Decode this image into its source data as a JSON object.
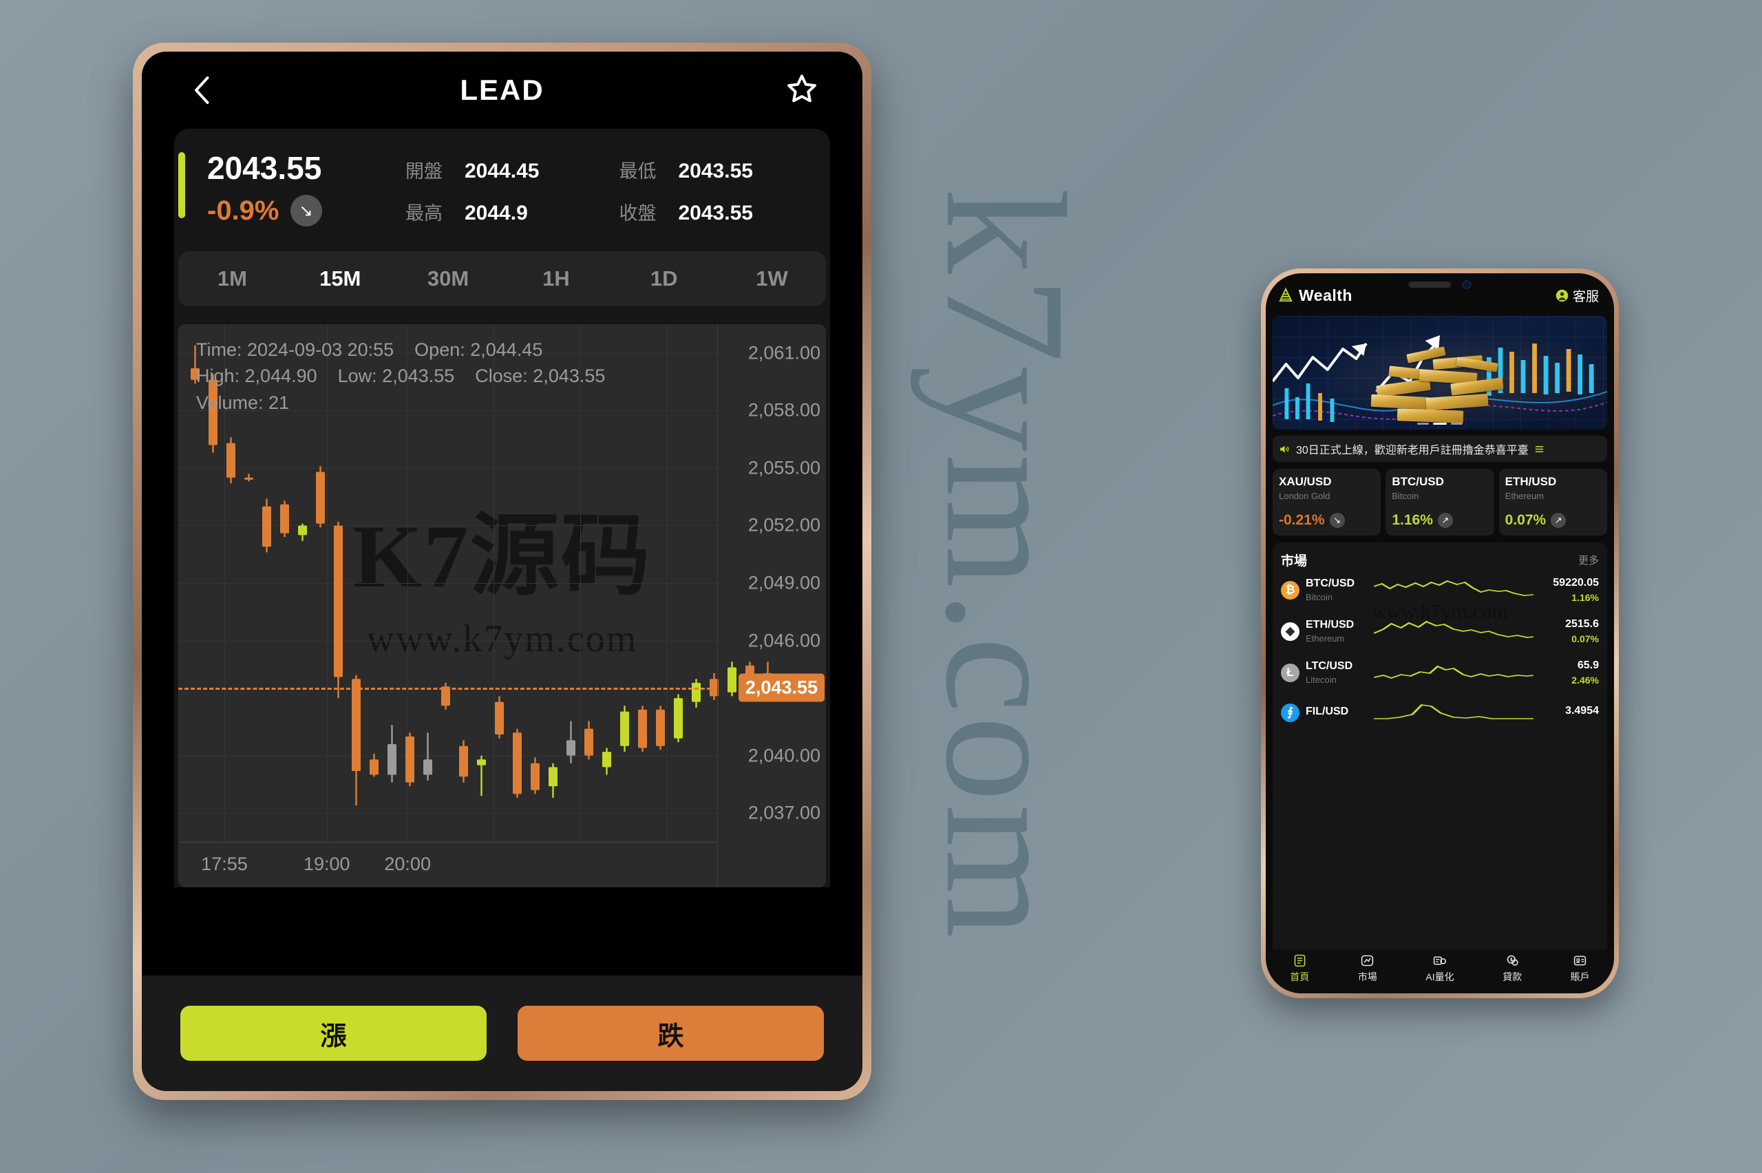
{
  "watermark": {
    "background_text": "k7ym.com",
    "chart_text_main": "K7源码",
    "chart_text_sub": "www.k7ym.com",
    "phone_text": "www.k7ym.com"
  },
  "tablet": {
    "topbar": {
      "back_icon": "chevron-left-icon",
      "title": "LEAD",
      "favorite_icon": "star-outline-icon"
    },
    "quote": {
      "price": "2043.55",
      "change_pct": "-0.9%",
      "change_direction_icon": "arrow-down-right-icon",
      "stats": [
        {
          "label": "開盤",
          "value": "2044.45"
        },
        {
          "label": "最低",
          "value": "2043.55"
        },
        {
          "label": "最高",
          "value": "2044.9"
        },
        {
          "label": "收盤",
          "value": "2043.55"
        }
      ],
      "accent_bar_color": "#c8dc2c",
      "down_color": "#e07a32"
    },
    "timeframes": [
      {
        "label": "1M",
        "active": false
      },
      {
        "label": "15M",
        "active": true
      },
      {
        "label": "30M",
        "active": false
      },
      {
        "label": "1H",
        "active": false
      },
      {
        "label": "1D",
        "active": false
      },
      {
        "label": "1W",
        "active": false
      }
    ],
    "ohlc_tooltip": {
      "line1": "Time: 2024-09-03 20:55    Open: 2,044.45",
      "line2": "High: 2,044.90    Low: 2,043.55    Close: 2,043.55",
      "line3": "Volume: 21"
    },
    "actions": [
      {
        "label": "漲",
        "color": "#cadc2b"
      },
      {
        "label": "跌",
        "color": "#dd7d3a"
      }
    ]
  },
  "chart_data": {
    "type": "candlestick",
    "title": "LEAD 15M",
    "xlabel": "",
    "ylabel": "",
    "ylim": [
      2035.5,
      2062.5
    ],
    "y_ticks": [
      "2,061.00",
      "2,058.00",
      "2,055.00",
      "2,052.00",
      "2,049.00",
      "2,046.00",
      "2,040.00",
      "2,037.00"
    ],
    "y_tick_values": [
      2061,
      2058,
      2055,
      2052,
      2049,
      2046,
      2040,
      2037
    ],
    "highlight_price": "2,043.55",
    "highlight_price_value": 2043.55,
    "x_ticks": [
      "17:55",
      "19:00",
      "20:00"
    ],
    "x_tick_positions": [
      0.06,
      0.25,
      0.4
    ],
    "grid": true,
    "up_color": "#c5da2a",
    "down_color": "#df7f35",
    "candles": [
      {
        "o": 2060.2,
        "h": 2061.4,
        "l": 2059.4,
        "c": 2059.6,
        "dir": "down"
      },
      {
        "o": 2059.6,
        "h": 2059.9,
        "l": 2055.8,
        "c": 2056.2,
        "dir": "down"
      },
      {
        "o": 2056.3,
        "h": 2056.6,
        "l": 2054.2,
        "c": 2054.5,
        "dir": "down"
      },
      {
        "o": 2054.5,
        "h": 2054.7,
        "l": 2054.3,
        "c": 2054.4,
        "dir": "down"
      },
      {
        "o": 2053.0,
        "h": 2053.4,
        "l": 2050.6,
        "c": 2050.9,
        "dir": "down"
      },
      {
        "o": 2053.1,
        "h": 2053.3,
        "l": 2051.4,
        "c": 2051.6,
        "dir": "down"
      },
      {
        "o": 2052.0,
        "h": 2052.1,
        "l": 2051.2,
        "c": 2051.5,
        "dir": "up"
      },
      {
        "o": 2054.8,
        "h": 2055.1,
        "l": 2051.9,
        "c": 2052.1,
        "dir": "down"
      },
      {
        "o": 2052.0,
        "h": 2052.2,
        "l": 2043.0,
        "c": 2044.1,
        "dir": "down"
      },
      {
        "o": 2044.0,
        "h": 2044.2,
        "l": 2037.4,
        "c": 2039.2,
        "dir": "down"
      },
      {
        "o": 2039.8,
        "h": 2040.1,
        "l": 2038.9,
        "c": 2039.0,
        "dir": "down"
      },
      {
        "o": 2040.6,
        "h": 2041.6,
        "l": 2038.6,
        "c": 2039.0,
        "dir": "neutral"
      },
      {
        "o": 2041.0,
        "h": 2041.2,
        "l": 2038.4,
        "c": 2038.6,
        "dir": "down"
      },
      {
        "o": 2039.8,
        "h": 2041.2,
        "l": 2038.7,
        "c": 2039.0,
        "dir": "neutral"
      },
      {
        "o": 2043.6,
        "h": 2043.8,
        "l": 2042.4,
        "c": 2042.6,
        "dir": "down"
      },
      {
        "o": 2040.5,
        "h": 2040.8,
        "l": 2038.6,
        "c": 2038.9,
        "dir": "down"
      },
      {
        "o": 2039.5,
        "h": 2040.0,
        "l": 2037.9,
        "c": 2039.8,
        "dir": "up"
      },
      {
        "o": 2042.8,
        "h": 2043.1,
        "l": 2040.9,
        "c": 2041.1,
        "dir": "down"
      },
      {
        "o": 2041.2,
        "h": 2041.4,
        "l": 2037.8,
        "c": 2038.0,
        "dir": "down"
      },
      {
        "o": 2039.6,
        "h": 2039.9,
        "l": 2038.0,
        "c": 2038.2,
        "dir": "down"
      },
      {
        "o": 2038.4,
        "h": 2039.6,
        "l": 2037.8,
        "c": 2039.4,
        "dir": "up"
      },
      {
        "o": 2040.8,
        "h": 2041.8,
        "l": 2039.6,
        "c": 2040.0,
        "dir": "neutral"
      },
      {
        "o": 2041.4,
        "h": 2041.8,
        "l": 2039.8,
        "c": 2040.0,
        "dir": "down"
      },
      {
        "o": 2039.4,
        "h": 2040.4,
        "l": 2039.0,
        "c": 2040.2,
        "dir": "up"
      },
      {
        "o": 2040.5,
        "h": 2042.6,
        "l": 2040.2,
        "c": 2042.3,
        "dir": "up"
      },
      {
        "o": 2042.4,
        "h": 2042.6,
        "l": 2040.2,
        "c": 2040.4,
        "dir": "down"
      },
      {
        "o": 2042.4,
        "h": 2042.6,
        "l": 2040.3,
        "c": 2040.5,
        "dir": "down"
      },
      {
        "o": 2040.9,
        "h": 2043.2,
        "l": 2040.7,
        "c": 2043.0,
        "dir": "up"
      },
      {
        "o": 2042.8,
        "h": 2044.0,
        "l": 2042.5,
        "c": 2043.8,
        "dir": "up"
      },
      {
        "o": 2044.0,
        "h": 2044.3,
        "l": 2042.9,
        "c": 2043.1,
        "dir": "down"
      },
      {
        "o": 2043.3,
        "h": 2044.9,
        "l": 2043.1,
        "c": 2044.6,
        "dir": "up"
      },
      {
        "o": 2044.7,
        "h": 2044.9,
        "l": 2043.5,
        "c": 2043.6,
        "dir": "down"
      },
      {
        "o": 2044.3,
        "h": 2044.9,
        "l": 2043.5,
        "c": 2043.55,
        "dir": "down"
      }
    ]
  },
  "phone": {
    "status": {
      "logo_icon": "pyramid-logo-icon",
      "brand": "Wealth",
      "service_icon": "user-circle-icon",
      "service_label": "客服"
    },
    "hero": {
      "alt": "gold-bars-trading-banner",
      "dots": 3,
      "active_dot": 1
    },
    "marquee": {
      "speaker_icon": "speaker-icon",
      "text": "30日正式上線，歡迎新老用戶註冊擼金恭喜平臺",
      "menu_icon": "list-icon"
    },
    "tickers": [
      {
        "symbol": "XAU/USD",
        "name": "London Gold",
        "pct": "-0.21%",
        "dir": "down",
        "color": "#d9772f"
      },
      {
        "symbol": "BTC/USD",
        "name": "Bitcoin",
        "pct": "1.16%",
        "dir": "up",
        "color": "#c5da2a"
      },
      {
        "symbol": "ETH/USD",
        "name": "Ethereum",
        "pct": "0.07%",
        "dir": "up",
        "color": "#c5da2a"
      }
    ],
    "market": {
      "title": "市場",
      "more_label": "更多",
      "rows": [
        {
          "symbol": "BTC/USD",
          "name": "Bitcoin",
          "price": "59220.05",
          "pct": "1.16%",
          "icon": "bitcoin-icon",
          "icon_bg": "#f5a231",
          "icon_glyph": "₿"
        },
        {
          "symbol": "ETH/USD",
          "name": "Ethereum",
          "price": "2515.6",
          "pct": "0.07%",
          "icon": "ethereum-icon",
          "icon_bg": "#ffffff",
          "icon_glyph": "◆"
        },
        {
          "symbol": "LTC/USD",
          "name": "Litecoin",
          "price": "65.9",
          "pct": "2.46%",
          "icon": "litecoin-icon",
          "icon_bg": "#a6a6a6",
          "icon_glyph": "Ł"
        },
        {
          "symbol": "FIL/USD",
          "name": "",
          "price": "3.4954",
          "pct": "",
          "icon": "filecoin-icon",
          "icon_bg": "#1a9bf0",
          "icon_glyph": "⨎"
        }
      ]
    },
    "nav": [
      {
        "label": "首頁",
        "icon": "home-icon",
        "active": true
      },
      {
        "label": "市場",
        "icon": "market-icon",
        "active": false
      },
      {
        "label": "AI量化",
        "icon": "ai-quant-icon",
        "active": false
      },
      {
        "label": "貸款",
        "icon": "loan-icon",
        "active": false
      },
      {
        "label": "賬戶",
        "icon": "account-icon",
        "active": false
      }
    ]
  }
}
